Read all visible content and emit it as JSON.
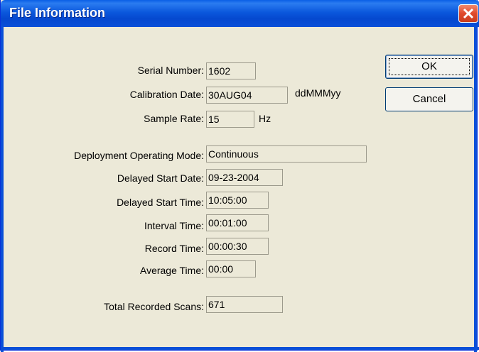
{
  "window": {
    "title": "File Information"
  },
  "buttons": {
    "ok_label": "OK",
    "cancel_label": "Cancel"
  },
  "fields": {
    "serial_number": {
      "label": "Serial Number:",
      "value": "1602"
    },
    "calibration_date": {
      "label": "Calibration Date:",
      "value": "30AUG04",
      "format_hint": "ddMMMyy"
    },
    "sample_rate": {
      "label": "Sample Rate:",
      "value": "15",
      "unit": "Hz"
    },
    "deployment_operating_mode": {
      "label": "Deployment Operating Mode:",
      "value": "Continuous"
    },
    "delayed_start_date": {
      "label": "Delayed Start Date:",
      "value": "09-23-2004"
    },
    "delayed_start_time": {
      "label": "Delayed Start Time:",
      "value": "10:05:00"
    },
    "interval_time": {
      "label": "Interval Time:",
      "value": "00:01:00"
    },
    "record_time": {
      "label": "Record Time:",
      "value": "00:00:30"
    },
    "average_time": {
      "label": "Average Time:",
      "value": "00:00"
    },
    "total_recorded_scans": {
      "label": "Total Recorded Scans:",
      "value": "671"
    }
  },
  "colors": {
    "titlebar": "#0a4fd8",
    "dialog_bg": "#ece9d8",
    "close_button": "#e0492b"
  }
}
